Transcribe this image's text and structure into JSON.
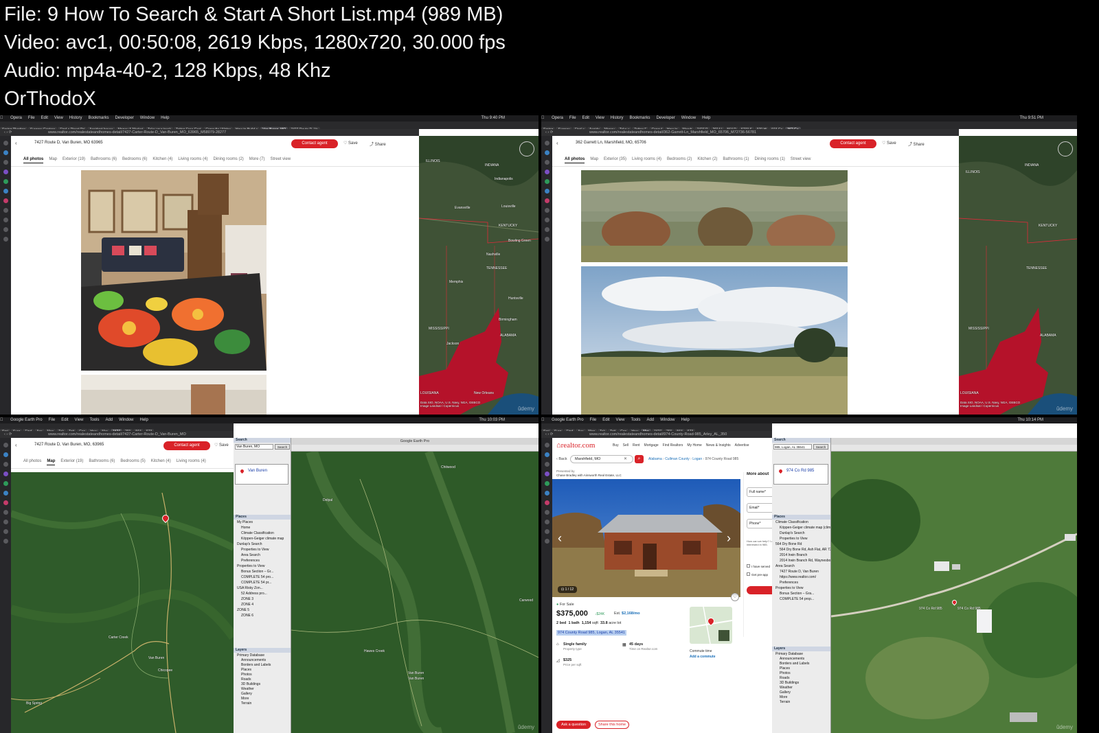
{
  "header": {
    "file_line": "File: 9  How To Search & Start A Short List.mp4 (989 MB)",
    "video_line": "Video: avc1, 00:50:08, 2619 Kbps, 1280x720, 30.000 fps",
    "audio_line": "Audio: mp4a-40-2, 128 Kbps, 48 Khz",
    "author": "OrThodoX"
  },
  "watermark": "ûdemy",
  "q1": {
    "menu": [
      "Opera",
      "File",
      "Edit",
      "View",
      "History",
      "Bookmarks",
      "Developer",
      "Window",
      "Help"
    ],
    "clock": "Thu 9:40 PM",
    "tabs": [
      "Spring Planting",
      "Surgery Centers",
      "Find a Direct Pri",
      "Accident Insura",
      "Money & Market",
      "Take your track",
      "Tattoo Free Grat",
      "Consulta | Nidos",
      "How to Build a",
      "Van Buren, MO",
      "7427 Route D, Va"
    ],
    "active_tab": 9,
    "url": "www.realtor.com/realestateandhomes-detail/7427-Carter-Route-D_Van-Buren_MO_63965_M58079-28277",
    "title": "7427 Route D, Van Buren, MO 63965",
    "contact": "Contact agent",
    "save": "Save",
    "share": "Share",
    "photo_tabs": [
      "All photos",
      "Map",
      "Exterior (19)",
      "Bathrooms (6)",
      "Bedrooms (6)",
      "Kitchen (4)",
      "Living rooms (4)",
      "Dining rooms (2)",
      "More (7)",
      "Street view"
    ],
    "map_labels": [
      "ILLINOIS",
      "INDIANA",
      "Indianapolis",
      "KENTUCKY",
      "Louisville",
      "Evansville",
      "TENNESSEE",
      "Nashville",
      "Memphis",
      "MISSISSIPPI",
      "ALABAMA",
      "Jackson",
      "LOUISIANA",
      "New Orleans",
      "Birmingham",
      "Huntsville",
      "Bowling Green"
    ],
    "map_credit": "Data SIO, NOAA, U.S. Navy, NGA, GEBCO\nImage Landsat / Copernicus"
  },
  "q2": {
    "menu": [
      "Opera",
      "File",
      "Edit",
      "View",
      "History",
      "Bookmarks",
      "Developer",
      "Window",
      "Help"
    ],
    "clock": "Thu 9:51 PM",
    "tabs": [
      "Spring",
      "Surgery",
      "Find a",
      "Accide",
      "Money",
      "Take y",
      "Tattoo F",
      "Consul",
      "How to",
      "Marsh",
      "7427 R",
      "2014 I",
      "564 D",
      "6733 S",
      "970 Hi",
      "974 Co",
      "362 Ga"
    ],
    "active_tab": 16,
    "url": "www.realtor.com/realestateandhomes-detail/362-Garrett-Ln_Marshfield_MO_65706_M72736-56781",
    "title": "362 Garrett Ln, Marshfield, MO, 65706",
    "contact": "Contact agent",
    "save": "Save",
    "share": "Share",
    "photo_tabs": [
      "All photos",
      "Map",
      "Exterior (35)",
      "Living rooms (4)",
      "Bedrooms (2)",
      "Kitchen (2)",
      "Bathrooms (1)",
      "Dining rooms (1)",
      "Street view"
    ],
    "map_labels": [
      "ILLINOIS",
      "INDIANA",
      "KENTUCKY",
      "TENNESSEE",
      "MISSISSIPPI",
      "ALABAMA",
      "LOUISIANA"
    ],
    "map_credit": "Data SIO, NOAA, U.S. Navy, NGA, GEBCO\nImage Landsat / Copernicus"
  },
  "q3": {
    "menu": [
      "Google Earth Pro",
      "File",
      "Edit",
      "View",
      "Tools",
      "Add",
      "Window",
      "Help"
    ],
    "clock": "Thu 10:03 PM",
    "tabs": [
      "Spri",
      "Surg",
      "Find",
      "Acc",
      "Mon",
      "Tak",
      "Tatt",
      "Con",
      "How",
      "Mar",
      "7427",
      "201",
      "564",
      "673"
    ],
    "active_tab": 10,
    "url": "www.realtor.com/realestateandhomes-detail/7427-Carter-Route-D_Van-Buren_MO",
    "title": "7427 Route D, Van Buren, MO, 63965",
    "contact": "Contact agent",
    "save": "Save",
    "photo_tabs": [
      "All photos",
      "Map",
      "Exterior (19)",
      "Bathrooms (6)",
      "Bedrooms (5)",
      "Kitchen (4)",
      "Living rooms (4)"
    ],
    "map_labels": [
      "Van Buren",
      "Chicopee",
      "Carter Creek",
      "Big Spring"
    ],
    "ge_title": "Google Earth Pro",
    "ge_search_label": "Search",
    "ge_search_value": "Van Buren, MO",
    "ge_search_btn": "Search",
    "ge_result": "Van Buren",
    "ge_places_label": "Places",
    "ge_places": [
      "My Places",
      "Home",
      "Climate Classification",
      "Köppen-Geiger climate map",
      "Dunlap's Search",
      "Properties to View",
      "Area Search",
      "Preferences",
      "Properties to View",
      "Bonus Section – Gr...",
      "COMPLETE 54 pro...",
      "COMPLETE 54 pr...",
      "USA Risky Zon...",
      "52 Address pro...",
      "ZONE 3",
      "ZONE 4",
      "ZONE 5",
      "ZONE 6"
    ],
    "ge_layers_label": "Layers",
    "ge_layers": [
      "Primary Database",
      "Announcements",
      "Borders and Labels",
      "Places",
      "Photos",
      "Roads",
      "3D Buildings",
      "Weather",
      "Gallery",
      "More",
      "Terrain"
    ],
    "ge_map_labels": [
      "Chitwood",
      "Delpal",
      "Van Buren",
      "Van Buren",
      "Hawes Creek",
      "Carwood"
    ]
  },
  "q4": {
    "menu": [
      "Google Earth Pro",
      "File",
      "Edit",
      "View",
      "Tools",
      "Add",
      "Window",
      "Help"
    ],
    "clock": "Thu 10:14 PM",
    "tabs": [
      "Spri",
      "Surg",
      "Find",
      "Acc",
      "Mon",
      "Tak",
      "Tatt",
      "Con",
      "How",
      "Mar",
      "7427",
      "201",
      "564",
      "673"
    ],
    "active_tab": 9,
    "url": "www.realtor.com/realestateandhomes-detail/974-County-Road-985_Arley_AL_350",
    "logo": "realtor.com",
    "nav": [
      "Buy",
      "Sell",
      "Rent",
      "Mortgage",
      "Find Realtors",
      "My Home",
      "News & Insights",
      "Advertise"
    ],
    "search_value": "Marshfield, MO",
    "back": "Back",
    "crumbs": [
      "Alabama",
      "Cullman County",
      "Logan",
      "974 County Road 985"
    ],
    "presented_by": "Presented by",
    "agent": "Chase Bradley with Ainsworth Real Estate, LLC",
    "photo_count": "1 / 12",
    "status": "For Sale",
    "price": "$375,000",
    "price_change": "↓$24K",
    "est_label": "Est.",
    "est_payment": "$2,168/mo",
    "beds": "2 bed",
    "baths": "1 bath",
    "sqft": "1,154",
    "sqft_unit": "sqft",
    "lot": "33.8",
    "lot_unit": "acre lot",
    "address": "974 County Road 985, Logan, AL 35541",
    "type_value": "Single family",
    "type_label": "Property type",
    "days_value": "45 days",
    "days_label": "Time on Realtor.com",
    "ppsf_value": "$325",
    "ppsf_label": "Price per sqft",
    "commute": "Commute time",
    "add_commute": "Add a commute",
    "ask_btn": "Ask a question",
    "share_btn": "Share this home",
    "more_about": "More about",
    "form_fields": [
      "Full name*",
      "Email*",
      "Phone*"
    ],
    "form_note": "How can we help? I am interested in 985.",
    "checks": [
      "I have served",
      "Get pre-app"
    ],
    "ge_search_value": "985, Logan, AL 35541",
    "ge_search_btn": "Search",
    "ge_result": "974 Co Rd 985",
    "ge_places_label": "Places",
    "ge_places": [
      "Climate Classification",
      "Köppen-Geiger climate map (clim)",
      "Dunlap's Search",
      "Properties to View",
      "564 Dry Bone Rd",
      "564 Dry Bone Rd, Ash Flat, AR 72513",
      "2014 Irwin Branch",
      "2014 Irwin Branch Rd, Waynesboro",
      "Area Search",
      "7427 Route D, Van Buren",
      "https://www.realtor.com/",
      "Preferences",
      "Properties to View",
      "Bonus Section – Gra...",
      "COMPLETE 54 prop..."
    ],
    "ge_layers_label": "Layers",
    "ge_layers": [
      "Primary Database",
      "Announcements",
      "Borders and Labels",
      "Places",
      "Photos",
      "Roads",
      "3D Buildings",
      "Weather",
      "Gallery",
      "More",
      "Terrain"
    ],
    "ge_map_labels": [
      "974 Co Rd 985",
      "974 Co Rd 985"
    ]
  }
}
